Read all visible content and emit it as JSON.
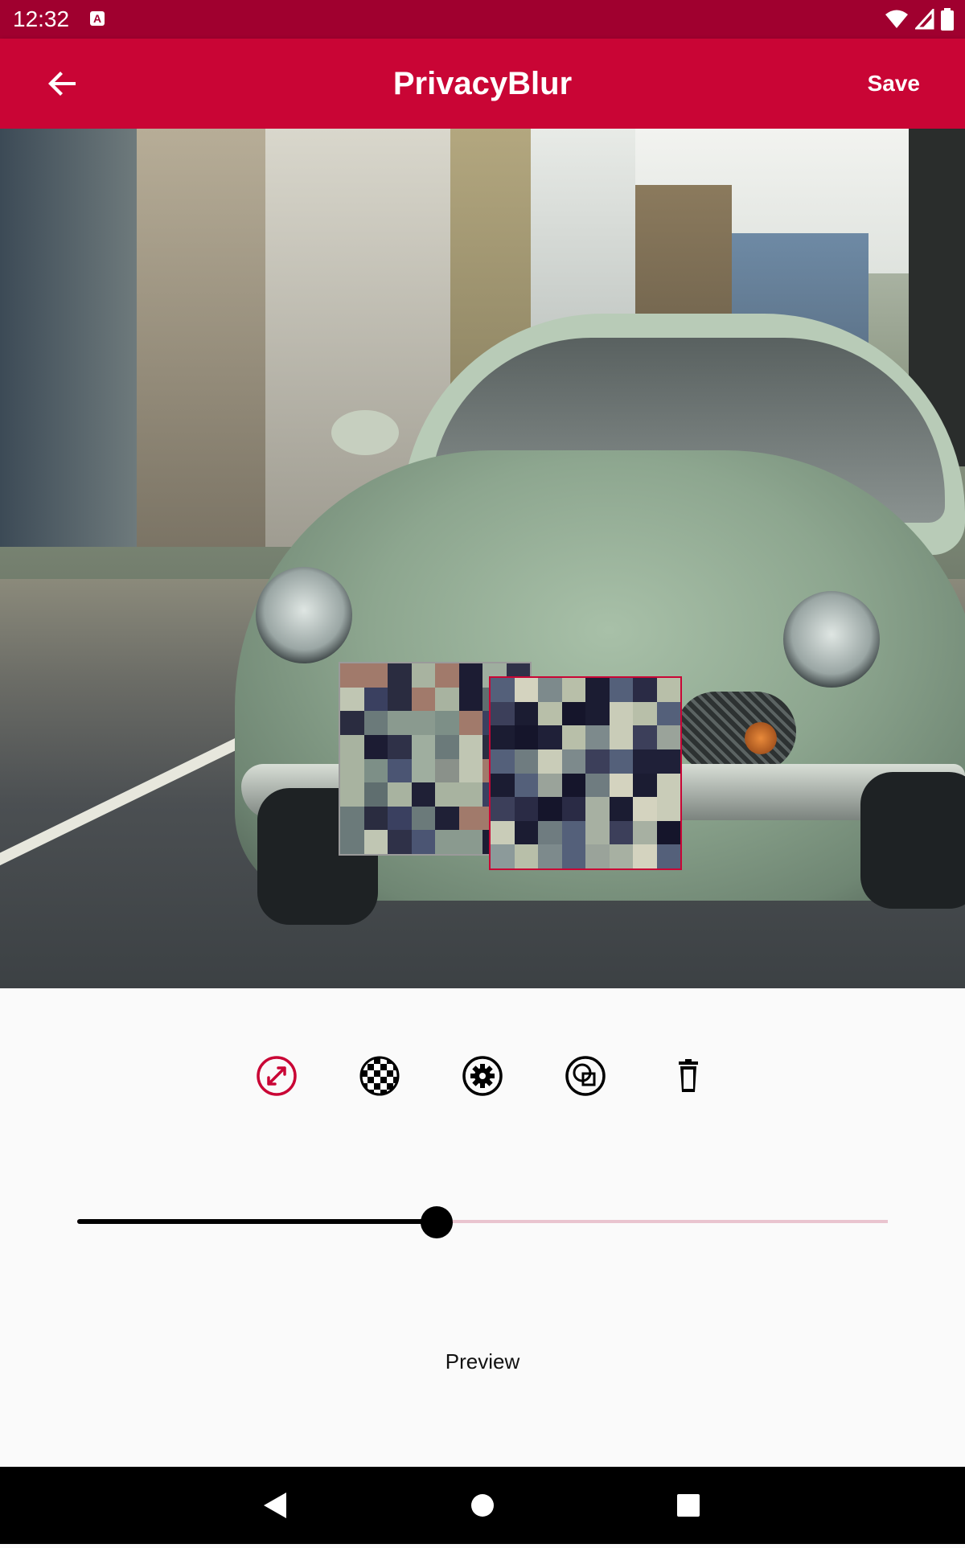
{
  "status_bar": {
    "time": "12:32",
    "notification_icon": "a-icon",
    "icons": [
      "wifi-icon",
      "signal-icon",
      "battery-icon"
    ]
  },
  "app_bar": {
    "title": "PrivacyBlur",
    "save_label": "Save",
    "back_icon": "arrow-back-icon"
  },
  "colors": {
    "primary": "#c90535",
    "primary_dark": "#a0002f",
    "background": "#fafafa"
  },
  "toolbar": {
    "tools": [
      {
        "name": "resize-tool",
        "icon": "resize-icon",
        "active": true
      },
      {
        "name": "pixelate-tool",
        "icon": "checkerboard-icon",
        "active": false
      },
      {
        "name": "settings-tool",
        "icon": "gear-icon",
        "active": false
      },
      {
        "name": "shape-tool",
        "icon": "shapes-icon",
        "active": false
      },
      {
        "name": "delete-tool",
        "icon": "trash-icon",
        "active": false
      }
    ]
  },
  "slider": {
    "value_fraction": 0.443
  },
  "preview": {
    "label": "Preview"
  },
  "nav_bar": {
    "buttons": [
      "back-triangle-icon",
      "home-circle-icon",
      "recents-square-icon"
    ]
  }
}
